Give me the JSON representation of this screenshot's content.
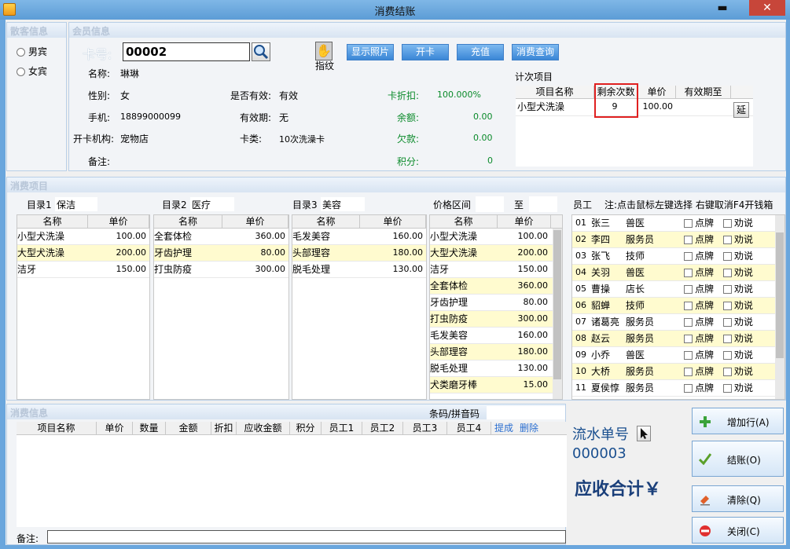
{
  "window": {
    "title": "消费结账",
    "minimize": "▬",
    "close": "✕"
  },
  "guest": {
    "header": "散客信息",
    "options": [
      "男宾",
      "女宾"
    ]
  },
  "member": {
    "header": "会员信息",
    "card_label": "卡号:",
    "card_value": "00002",
    "fingerprint_label": "指纹",
    "buttons": {
      "photo": "显示照片",
      "open_card": "开卡",
      "recharge": "充值",
      "query": "消费查询"
    },
    "fields": {
      "name_label": "名称:",
      "name": "琳琳",
      "gender_label": "性别:",
      "gender": "女",
      "phone_label": "手机:",
      "phone": "18899000099",
      "org_label": "开卡机构:",
      "org": "宠物店",
      "note_label": "备注:",
      "valid_label": "是否有效:",
      "valid": "有效",
      "expiry_label": "有效期:",
      "expiry": "无",
      "type_label": "卡类:",
      "type": "10次洗澡卡",
      "discount_label": "卡折扣:",
      "discount": "100.000%",
      "balance_label": "余额:",
      "balance": "0.00",
      "debt_label": "欠款:",
      "debt": "0.00",
      "points_label": "积分:",
      "points": "0"
    },
    "count_items": {
      "title": "计次项目",
      "headers": [
        "项目名称",
        "剩余次数",
        "单价",
        "有效期至"
      ],
      "rows": [
        {
          "name": "小型犬洗澡",
          "remaining": "9",
          "price": "100.00",
          "expiry": ""
        }
      ],
      "extend_button": "延"
    }
  },
  "consume": {
    "header": "消费项目",
    "cat1": {
      "label": "目录1",
      "name": "保洁",
      "headers": [
        "名称",
        "单价"
      ],
      "rows": [
        {
          "name": "小型犬洗澡",
          "price": "100.00"
        },
        {
          "name": "大型犬洗澡",
          "price": "200.00"
        },
        {
          "name": "洁牙",
          "price": "150.00"
        }
      ]
    },
    "cat2": {
      "label": "目录2",
      "name": "医疗",
      "headers": [
        "名称",
        "单价"
      ],
      "rows": [
        {
          "name": "全套体检",
          "price": "360.00"
        },
        {
          "name": "牙齿护理",
          "price": "80.00"
        },
        {
          "name": "打虫防疫",
          "price": "300.00"
        }
      ]
    },
    "cat3": {
      "label": "目录3",
      "name": "美容",
      "headers": [
        "名称",
        "单价"
      ],
      "rows": [
        {
          "name": "毛发美容",
          "price": "160.00"
        },
        {
          "name": "头部理容",
          "price": "180.00"
        },
        {
          "name": "脱毛处理",
          "price": "130.00"
        }
      ]
    },
    "price_range": {
      "label": "价格区间",
      "to": "至",
      "headers": [
        "名称",
        "单价"
      ],
      "rows": [
        {
          "name": "小型犬洗澡",
          "price": "100.00"
        },
        {
          "name": "大型犬洗澡",
          "price": "200.00"
        },
        {
          "name": "洁牙",
          "price": "150.00"
        },
        {
          "name": "全套体检",
          "price": "360.00"
        },
        {
          "name": "牙齿护理",
          "price": "80.00"
        },
        {
          "name": "打虫防疫",
          "price": "300.00"
        },
        {
          "name": "毛发美容",
          "price": "160.00"
        },
        {
          "name": "头部理容",
          "price": "180.00"
        },
        {
          "name": "脱毛处理",
          "price": "130.00"
        },
        {
          "name": "犬类磨牙棒",
          "price": "15.00"
        }
      ]
    },
    "staff": {
      "label": "员工",
      "note": "注:点击鼠标左键选择 右键取消F4开钱箱",
      "assign_label": "点牌",
      "persuade_label": "劝说",
      "rows": [
        {
          "no": "01",
          "name": "张三",
          "role": "兽医"
        },
        {
          "no": "02",
          "name": "李四",
          "role": "服务员"
        },
        {
          "no": "03",
          "name": "张飞",
          "role": "技师"
        },
        {
          "no": "04",
          "name": "关羽",
          "role": "兽医"
        },
        {
          "no": "05",
          "name": "曹操",
          "role": "店长"
        },
        {
          "no": "06",
          "name": "貂蝉",
          "role": "技师"
        },
        {
          "no": "07",
          "name": "诸葛亮",
          "role": "服务员"
        },
        {
          "no": "08",
          "name": "赵云",
          "role": "服务员"
        },
        {
          "no": "09",
          "name": "小乔",
          "role": "兽医"
        },
        {
          "no": "10",
          "name": "大桥",
          "role": "服务员"
        },
        {
          "no": "11",
          "name": "夏侯惇",
          "role": "服务员"
        }
      ]
    }
  },
  "bill": {
    "header": "消费信息",
    "barcode_label": "条码/拼音码",
    "headers": [
      "项目名称",
      "单价",
      "数量",
      "金额",
      "折扣",
      "应收金额",
      "积分",
      "员工1",
      "员工2",
      "员工3",
      "员工4"
    ],
    "commission_link": "提成",
    "delete_link": "删除",
    "note_label": "备注:"
  },
  "summary": {
    "serial_label": "流水单号",
    "serial": "000003",
    "total_label": "应收合计￥"
  },
  "actions": {
    "add_row": "增加行(A)",
    "checkout": "结账(O)",
    "clear": "清除(Q)",
    "close": "关闭(C)"
  }
}
